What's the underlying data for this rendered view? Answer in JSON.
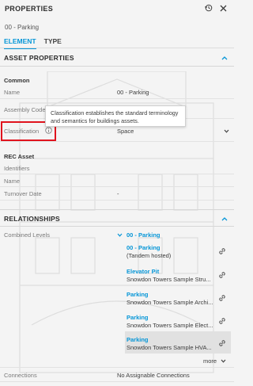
{
  "header": {
    "title": "PROPERTIES",
    "history_icon": "history-icon",
    "close_icon": "close-icon",
    "subtitle": "00 - Parking"
  },
  "tabs": [
    {
      "label": "ELEMENT",
      "active": true
    },
    {
      "label": "TYPE",
      "active": false
    }
  ],
  "asset_properties": {
    "title": "ASSET PROPERTIES",
    "common_title": "Common",
    "rows": [
      {
        "label": "Name",
        "value": "00 - Parking"
      },
      {
        "label": "Assembly Code",
        "value": ""
      },
      {
        "label": "Classification",
        "value": "Space"
      }
    ],
    "tooltip": "Classification establishes the standard terminology and semantics for buildings assets.",
    "rec_title": "REC Asset",
    "rec_rows": [
      {
        "label": "Identifiers",
        "value": ""
      },
      {
        "label": "Name",
        "value": ""
      },
      {
        "label": "Turnover Date",
        "value": "-"
      }
    ]
  },
  "relationships": {
    "title": "RELATIONSHIPS",
    "combined_levels_label": "Combined Levels",
    "combined_levels_value": "00 - Parking",
    "items": [
      {
        "title": "00 - Parking",
        "subtitle": "(Tandem hosted)"
      },
      {
        "title": "Elevator Pit",
        "subtitle": "Snowdon Towers Sample Stru..."
      },
      {
        "title": "Parking",
        "subtitle": "Snowdon Towers Sample Archi..."
      },
      {
        "title": "Parking",
        "subtitle": "Snowdon Towers Sample Elect..."
      },
      {
        "title": "Parking",
        "subtitle": "Snowdon Towers Sample HVA..."
      }
    ],
    "more_label": "more",
    "connections_label": "Connections",
    "connections_value": "No Assignable Connections"
  },
  "colors": {
    "accent": "#0696d7",
    "highlight": "#e0141e"
  }
}
